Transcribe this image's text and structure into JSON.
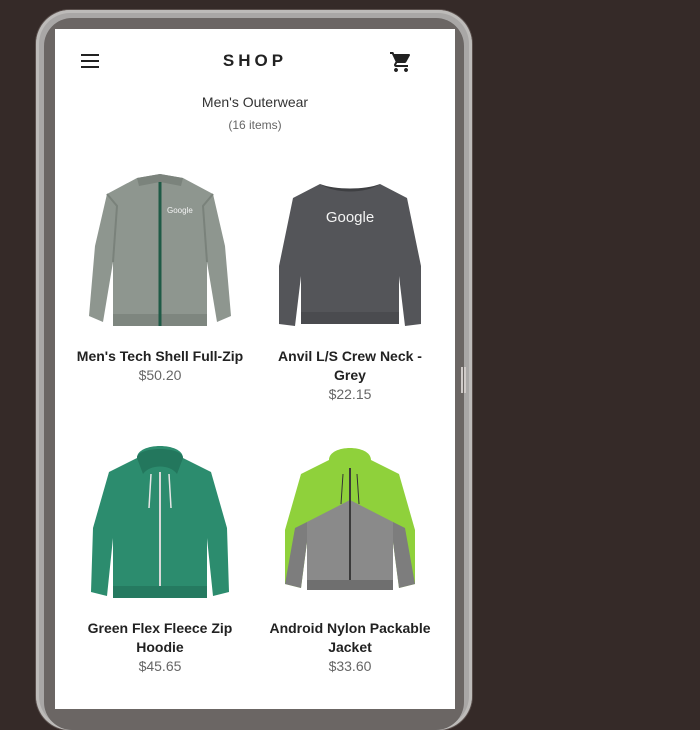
{
  "app": {
    "title": "SHOP"
  },
  "category": {
    "name": "Men's Outerwear",
    "count": "(16 items)"
  },
  "products": [
    {
      "name": "Men's Tech Shell Full-Zip",
      "price": "$50.20",
      "image_icon": "grey-zip-jacket"
    },
    {
      "name": "Anvil L/S Crew Neck - Grey",
      "price": "$22.15",
      "image_icon": "grey-crewneck-sweatshirt"
    },
    {
      "name": "Green Flex Fleece Zip Hoodie",
      "price": "$45.65",
      "image_icon": "green-zip-hoodie"
    },
    {
      "name": "Android Nylon Packable Jacket",
      "price": "$33.60",
      "image_icon": "green-grey-windbreaker"
    }
  ],
  "colors": {
    "background": "#352a28",
    "screen": "#ffffff",
    "text_primary": "#222222",
    "text_secondary": "#666666"
  }
}
